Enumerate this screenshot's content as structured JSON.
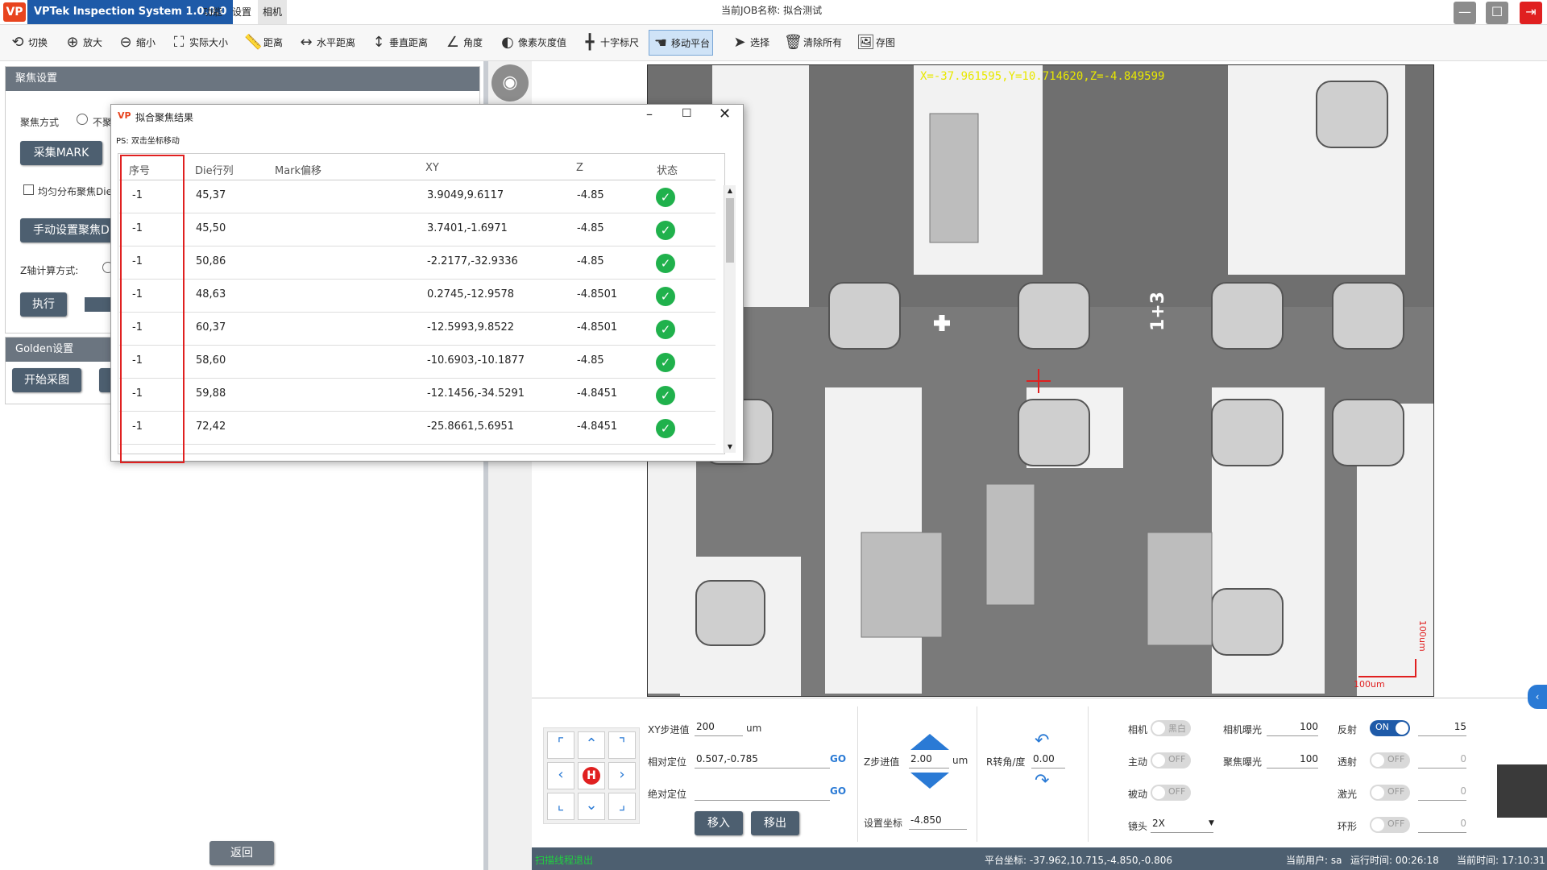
{
  "app": {
    "logo": "VP",
    "title": "VPTek Inspection System 1.0.0.0",
    "menu": [
      "功能",
      "设置",
      "相机"
    ],
    "job_label": "当前JOB名称: 拟合测试"
  },
  "toolbar": [
    {
      "label": "切换",
      "icon": "switch-icon",
      "glyph": "⟲"
    },
    {
      "label": "放大",
      "icon": "zoom-in-icon",
      "glyph": "⊕"
    },
    {
      "label": "缩小",
      "icon": "zoom-out-icon",
      "glyph": "⊖"
    },
    {
      "label": "实际大小",
      "icon": "actual-size-icon",
      "glyph": "⛶"
    },
    {
      "label": "距离",
      "icon": "ruler-icon",
      "glyph": "📏"
    },
    {
      "label": "水平距离",
      "icon": "horizontal-distance-icon",
      "glyph": "↔"
    },
    {
      "label": "垂直距离",
      "icon": "vertical-distance-icon",
      "glyph": "↕"
    },
    {
      "label": "角度",
      "icon": "angle-icon",
      "glyph": "∠"
    },
    {
      "label": "像素灰度值",
      "icon": "contrast-icon",
      "glyph": "◐"
    },
    {
      "label": "十字标尺",
      "icon": "crosshair-icon",
      "glyph": "╋"
    },
    {
      "label": "移动平台",
      "icon": "hand-icon",
      "glyph": "☚",
      "active": true
    },
    {
      "label": "选择",
      "icon": "cursor-icon",
      "glyph": "➤"
    },
    {
      "label": "清除所有",
      "icon": "trash-icon",
      "glyph": "🗑"
    },
    {
      "label": "存图",
      "icon": "save-image-icon",
      "glyph": "🖼"
    }
  ],
  "left_panel": {
    "focus_header": "聚焦设置",
    "focus_mode_label": "聚焦方式",
    "focus_mode_option": "不聚",
    "collect_mark_button": "采集MARK",
    "uniform_checkbox_label": "均匀分布聚焦Die",
    "manual_button": "手动设置聚焦Di",
    "z_calc_label": "Z轴计算方式:",
    "execute_button": "执行",
    "golden_header": "Golden设置",
    "start_capture_button": "开始采图",
    "back_button": "返回"
  },
  "dialog": {
    "title": "拟合聚焦结果",
    "hint": "PS: 双击坐标移动",
    "columns": [
      "序号",
      "Die行列",
      "Mark偏移",
      "XY",
      "Z",
      "状态"
    ],
    "rows": [
      {
        "index": "-1",
        "die": "45,37",
        "mark": "",
        "xy": "3.9049,9.6117",
        "z": "-4.85",
        "status": "ok"
      },
      {
        "index": "-1",
        "die": "45,50",
        "mark": "",
        "xy": "3.7401,-1.6971",
        "z": "-4.85",
        "status": "ok"
      },
      {
        "index": "-1",
        "die": "50,86",
        "mark": "",
        "xy": "-2.2177,-32.9336",
        "z": "-4.85",
        "status": "ok"
      },
      {
        "index": "-1",
        "die": "48,63",
        "mark": "",
        "xy": "0.2745,-12.9578",
        "z": "-4.8501",
        "status": "ok"
      },
      {
        "index": "-1",
        "die": "60,37",
        "mark": "",
        "xy": "-12.5993,9.8522",
        "z": "-4.8501",
        "status": "ok"
      },
      {
        "index": "-1",
        "die": "58,60",
        "mark": "",
        "xy": "-10.6903,-10.1877",
        "z": "-4.85",
        "status": "ok"
      },
      {
        "index": "-1",
        "die": "59,88",
        "mark": "",
        "xy": "-12.1456,-34.5291",
        "z": "-4.8451",
        "status": "ok"
      },
      {
        "index": "-1",
        "die": "72,42",
        "mark": "",
        "xy": "-25.8661,5.6951",
        "z": "-4.8451",
        "status": "ok"
      }
    ]
  },
  "image_view": {
    "coord_overlay": "X=-37.961595,Y=10.714620,Z=-4.849599",
    "scale_label_h": "100um",
    "scale_label_v": "100um",
    "die_marking": "1+3"
  },
  "motion": {
    "xy_step_label": "XY步进值",
    "xy_step_value": "200",
    "xy_step_unit": "um",
    "rel_pos_label": "相对定位",
    "rel_pos_value": "0.507,-0.785",
    "abs_pos_label": "绝对定位",
    "abs_pos_value": "",
    "go_label": "GO",
    "move_in_button": "移入",
    "move_out_button": "移出",
    "z_step_label": "Z步进值",
    "z_step_value": "2.00",
    "z_step_unit": "um",
    "set_coord_label": "设置坐标",
    "set_coord_value": "-4.850",
    "r_angle_label": "R转角/度",
    "r_angle_value": "0.00",
    "home_label": "H"
  },
  "camera_controls": {
    "camera_label": "相机",
    "camera_toggle": "黑白",
    "active_label": "主动",
    "passive_label": "被动",
    "lens_label": "镜头",
    "lens_value": "2X",
    "cam_exposure_label": "相机曝光",
    "cam_exposure_value": "100",
    "focus_exposure_label": "聚焦曝光",
    "focus_exposure_value": "100",
    "reflect_label": "反射",
    "reflect_value": "15",
    "transmit_label": "透射",
    "transmit_value": "0",
    "laser_label": "激光",
    "laser_value": "0",
    "ring_label": "环形",
    "ring_value": "0",
    "on_text": "ON",
    "off_text": "OFF"
  },
  "status": {
    "left": "扫描线程退出",
    "platform": "平台坐标: -37.962,10.715,-4.850,-0.806",
    "user": "当前用户: sa",
    "runtime": "运行时间: 00:26:18",
    "clock": "当前时间: 17:10:31"
  },
  "colors": {
    "accent": "#1e5aa8",
    "ok": "#20b14c",
    "highlight": "#e02020",
    "button": "#4d5f70"
  }
}
